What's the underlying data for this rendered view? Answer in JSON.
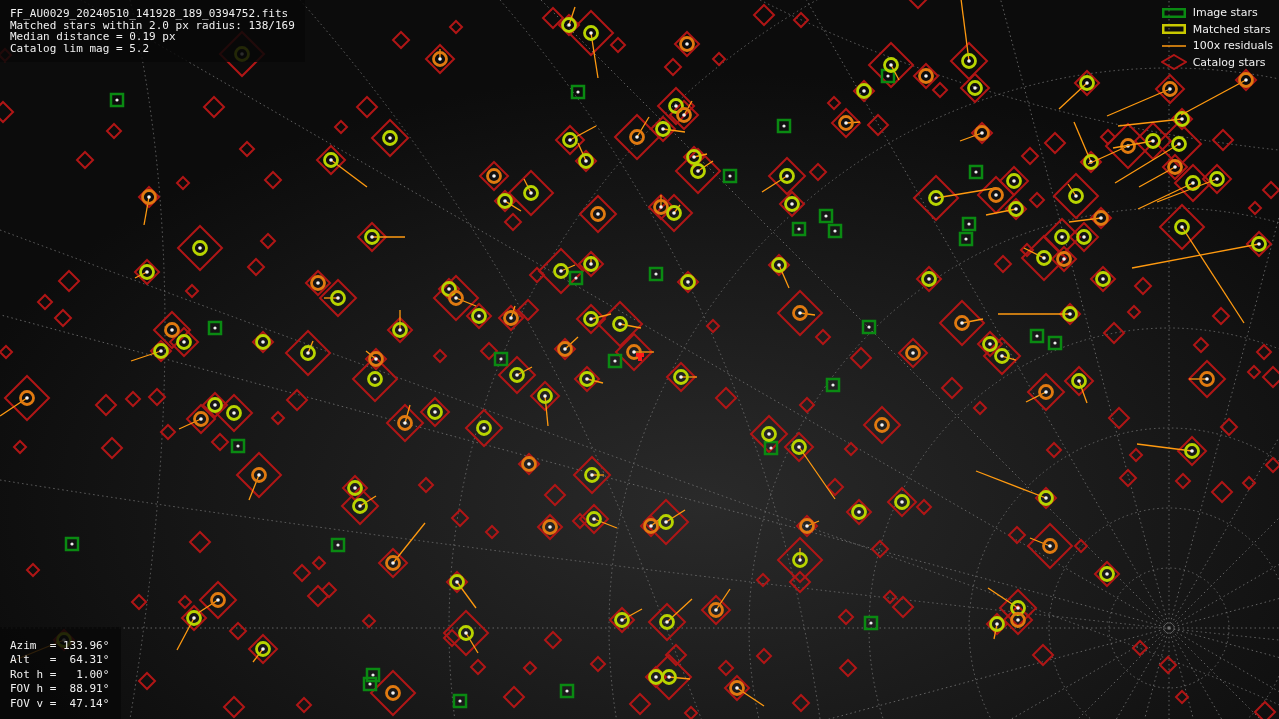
{
  "info_lines": [
    "FF_AU0029_20240510_141928_189_0394752.fits",
    "Matched stars within 2.0 px radius: 138/169",
    "Median distance = 0.19 px",
    "Catalog lim mag = 5.2"
  ],
  "legend": [
    {
      "kind": "image",
      "label": "Image stars"
    },
    {
      "kind": "matched",
      "label": "Matched stars"
    },
    {
      "kind": "residual",
      "label": "100x residuals"
    },
    {
      "kind": "catalog",
      "label": "Catalog stars"
    }
  ],
  "pointing": [
    "Azim  = 133.96°",
    "Alt   =  64.31°",
    "Rot h =   1.00°",
    "FOV h =  88.91°",
    "FOV v =  47.14°"
  ]
}
